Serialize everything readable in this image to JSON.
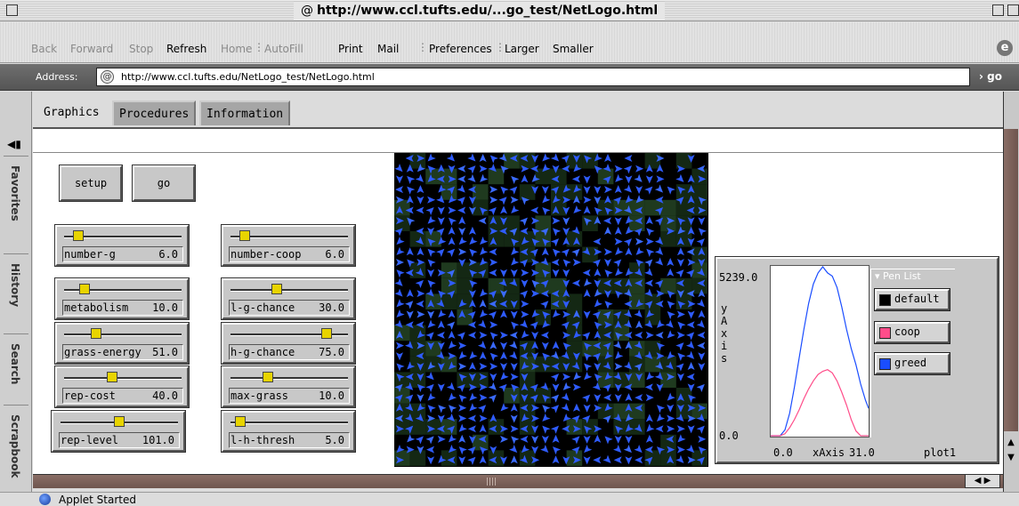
{
  "window": {
    "title": "http://www.ccl.tufts.edu/...go_test/NetLogo.html"
  },
  "toolbar": {
    "items": [
      {
        "label": "Back",
        "enabled": false
      },
      {
        "label": "Forward",
        "enabled": false
      },
      {
        "label": "Stop",
        "enabled": false
      },
      {
        "label": "Refresh",
        "enabled": true
      },
      {
        "label": "Home",
        "enabled": false
      },
      {
        "label": "AutoFill",
        "enabled": false
      },
      {
        "label": "Print",
        "enabled": true
      },
      {
        "label": "Mail",
        "enabled": true
      },
      {
        "label": "Preferences",
        "enabled": true
      },
      {
        "label": "Larger",
        "enabled": true
      },
      {
        "label": "Smaller",
        "enabled": true
      }
    ]
  },
  "address": {
    "label": "Address:",
    "url": "http://www.ccl.tufts.edu/NetLogo_test/NetLogo.html",
    "go_label": "go"
  },
  "explorer_tabs": [
    "Favorites",
    "History",
    "Search",
    "Scrapbook"
  ],
  "tabs": [
    {
      "label": "Graphics",
      "active": true
    },
    {
      "label": "Procedures",
      "active": false
    },
    {
      "label": "Information",
      "active": false
    }
  ],
  "buttons": {
    "setup": "setup",
    "go": "go"
  },
  "sliders": [
    {
      "name": "number-g",
      "value": "6.0",
      "fraction": 0.08
    },
    {
      "name": "number-coop",
      "value": "6.0",
      "fraction": 0.08
    },
    {
      "name": "metabolism",
      "value": "10.0",
      "fraction": 0.14
    },
    {
      "name": "l-g-chance",
      "value": "30.0",
      "fraction": 0.38
    },
    {
      "name": "grass-energy",
      "value": "51.0",
      "fraction": 0.25
    },
    {
      "name": "h-g-chance",
      "value": "75.0",
      "fraction": 0.85
    },
    {
      "name": "rep-cost",
      "value": "40.0",
      "fraction": 0.4
    },
    {
      "name": "max-grass",
      "value": "10.0",
      "fraction": 0.3
    },
    {
      "name": "rep-level",
      "value": "101.0",
      "fraction": 0.5
    },
    {
      "name": "l-h-thresh",
      "value": "5.0",
      "fraction": 0.04
    }
  ],
  "plot": {
    "name": "plot1",
    "ymax": "5239.0",
    "ymin": "0.0",
    "xmin": "0.0",
    "xmax": "31.0",
    "ylabel": "yAxis",
    "xlabel": "xAxis",
    "pen_list_title": "Pen List",
    "pens": [
      {
        "name": "default",
        "color": "#000000"
      },
      {
        "name": "coop",
        "color": "#ff4d8a"
      },
      {
        "name": "greed",
        "color": "#1a4dff"
      }
    ]
  },
  "chart_data": {
    "type": "line",
    "title": "plot1",
    "xlabel": "xAxis",
    "ylabel": "yAxis",
    "xlim": [
      0,
      31
    ],
    "ylim": [
      0,
      5239
    ],
    "x": [
      0,
      1.5,
      3,
      4.5,
      6,
      7.5,
      9,
      10.5,
      12,
      13.5,
      15,
      16.5,
      18,
      19.5,
      21,
      22.5,
      24,
      25.5,
      27,
      28.5,
      30,
      31
    ],
    "series": [
      {
        "name": "greed",
        "color": "#1a4dff",
        "values": [
          0,
          0,
          0,
          180,
          700,
          1500,
          2400,
          3300,
          4100,
          4700,
          5050,
          5239,
          5050,
          4950,
          4600,
          4000,
          3300,
          2700,
          2200,
          1600,
          1100,
          850
        ]
      },
      {
        "name": "coop",
        "color": "#ff4d8a",
        "values": [
          0,
          0,
          0,
          60,
          250,
          500,
          800,
          1150,
          1450,
          1700,
          1900,
          2000,
          2050,
          1950,
          1700,
          1350,
          950,
          500,
          150,
          0,
          0,
          0
        ]
      },
      {
        "name": "default",
        "color": "#000000",
        "values": []
      }
    ]
  },
  "status": {
    "text": "Applet Started"
  }
}
